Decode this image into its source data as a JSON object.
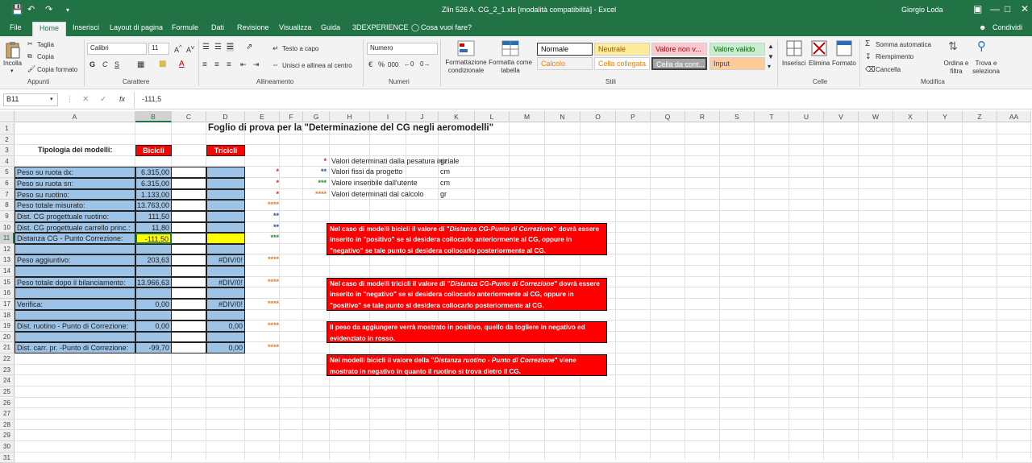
{
  "titlebar": {
    "doc": "Zlin 526 A. CG_2_1.xls  [modalità compatibilità]  -  Excel",
    "user": "Giorgio Loda"
  },
  "tabs": [
    "File",
    "Home",
    "Inserisci",
    "Layout di pagina",
    "Formule",
    "Dati",
    "Revisione",
    "Visualizza",
    "Guida",
    "3DEXPERIENCE",
    "Cosa vuoi fare?",
    "Condividi"
  ],
  "ribbon": {
    "clipboard": {
      "paste": "Incolla",
      "cut": "Taglia",
      "copy": "Copia",
      "format_painter": "Copia formato",
      "label": "Appunti"
    },
    "font": {
      "name": "Calibri",
      "size": "11",
      "label": "Carattere",
      "bold": "G",
      "italic": "C",
      "underline": "S"
    },
    "alignment": {
      "wrap": "Testo a capo",
      "merge": "Unisci e allinea al centro",
      "label": "Allineamento"
    },
    "number": {
      "format": "Numero",
      "label": "Numeri",
      "percent": "%",
      "thousands": "000"
    },
    "styles": {
      "conditional": "Formattazione condizionale",
      "table": "Formatta come tabella",
      "label": "Stili",
      "boxes": [
        {
          "t": "Normale",
          "bg": "#ffffff",
          "fg": "#000000"
        },
        {
          "t": "Neutrale",
          "bg": "#ffeb9c",
          "fg": "#9c5700"
        },
        {
          "t": "Valore non v...",
          "bg": "#ffc7ce",
          "fg": "#9c0006"
        },
        {
          "t": "Valore valido",
          "bg": "#c6efce",
          "fg": "#006100"
        },
        {
          "t": "Calcolo",
          "bg": "#f2f2f2",
          "fg": "#fa7d00"
        },
        {
          "t": "Cella collegata",
          "bg": "#ffffff",
          "fg": "#fa7d00"
        },
        {
          "t": "Cella da cont...",
          "bg": "#a5a5a5",
          "fg": "#ffffff"
        },
        {
          "t": "Input",
          "bg": "#ffcc99",
          "fg": "#3f3f76"
        }
      ]
    },
    "cells": {
      "insert": "Inserisci",
      "delete": "Elimina",
      "format": "Formato",
      "label": "Celle"
    },
    "editing": {
      "autosum": "Somma automatica",
      "fill": "Riempimento",
      "clear": "Cancella",
      "sort": "Ordina e filtra",
      "find": "Trova e seleziona",
      "label": "Modifica"
    }
  },
  "formula": {
    "namebox": "B11",
    "fx": "fx",
    "value": "-111,5"
  },
  "columns": [
    "A",
    "B",
    "C",
    "D",
    "E",
    "F",
    "G",
    "H",
    "I",
    "J",
    "K",
    "L",
    "M",
    "N",
    "O",
    "P",
    "Q",
    "R",
    "S",
    "T",
    "U",
    "V",
    "W",
    "X",
    "Y",
    "Z",
    "AA"
  ],
  "rows": [
    "1",
    "2",
    "3",
    "4",
    "5",
    "6",
    "7",
    "8",
    "9",
    "10",
    "11",
    "12",
    "13",
    "14",
    "15",
    "16",
    "17",
    "18",
    "19",
    "20",
    "21",
    "22",
    "23",
    "24",
    "25",
    "26",
    "27",
    "28",
    "29",
    "30",
    "31"
  ],
  "sheet": {
    "title": "Foglio di prova per la \"Determinazione del CG negli aeromodelli\"",
    "tipologia": "Tipologia dei modelli:",
    "bicicli": "Bicicli",
    "tricicli": "Tricicli",
    "labels": [
      "Peso su ruota dx:",
      "Peso su ruota sn:",
      "Peso su ruotino:",
      "Peso totale misurato:",
      "Dist. CG progettuale ruotino:",
      "Dist. CG progettuale carrello princ.:",
      "Distanza CG - Punto Correzione:",
      "Peso aggiuntivo:",
      "Peso totale dopo il bilanciamento:",
      "Verifica:",
      "Dist. ruotino - Punto di Correzione:",
      "Dist. carr. pr. -Punto di Correzione:"
    ],
    "b": [
      "6.315,00",
      "6.315,00",
      "1.133,00",
      "13.763,00",
      "111,50",
      "11,80",
      "-111,50",
      "203,63",
      "13.966,63",
      "0,00",
      "0,00",
      "-99,70"
    ],
    "d": [
      "#DIV/0!",
      "#DIV/0!",
      "#DIV/0!",
      "0,00",
      "0,00"
    ],
    "stars": [
      "*",
      "*",
      "*",
      "****",
      "**",
      "**",
      "***",
      "****",
      "****",
      "****",
      "****",
      "****"
    ],
    "legend": [
      {
        "s": "*",
        "t": "Valori determinati dalla pesatura iniziale",
        "u": "gr"
      },
      {
        "s": "**",
        "t": "Valori fissi da progetto",
        "u": "cm"
      },
      {
        "s": "***",
        "t": "Valore inseribile dall'utente",
        "u": "cm"
      },
      {
        "s": "****",
        "t": "Valori determinati dal calcolo",
        "u": "gr"
      }
    ],
    "notes": [
      {
        "a": "Nel caso di modelli bicicli il valore di \"",
        "i": "Distanza CG-Punto di Correzione",
        "b": "\" dovrà essere inserito in \"positivo\" se si desidera collocarlo anteriormente al CG, oppure in \"negativo\" se tale punto si desidera collocarlo posteriormente al CG."
      },
      {
        "a": "Nel caso di modelli tricicli il valore di \"",
        "i": "Distanza CG-Punto di Correzione",
        "b": "\" dovrà essere inserito in \"negativo\" se si desidera collocarlo anteriormente al CG, oppure in \"positivo\" se tale punto si desidera collocarlo posteriormente al CG."
      },
      {
        "a": "Il peso da aggiungere verrà mostrato in positivo, quello da togliere in negativo ed evidenziato in rosso.",
        "i": "",
        "b": ""
      },
      {
        "a": "Nei modelli bicicli il valore della \"",
        "i": "Distanza ruotino - Punto di Correzione",
        "b": "\" viene mostrato in negativo in quanto il ruotino si trova dietro il CG."
      }
    ]
  },
  "colors": {
    "accent": "#217346",
    "blue_cell": "#9dc3e6",
    "yellow_cell": "#ffff00",
    "red": "#ff0000"
  }
}
